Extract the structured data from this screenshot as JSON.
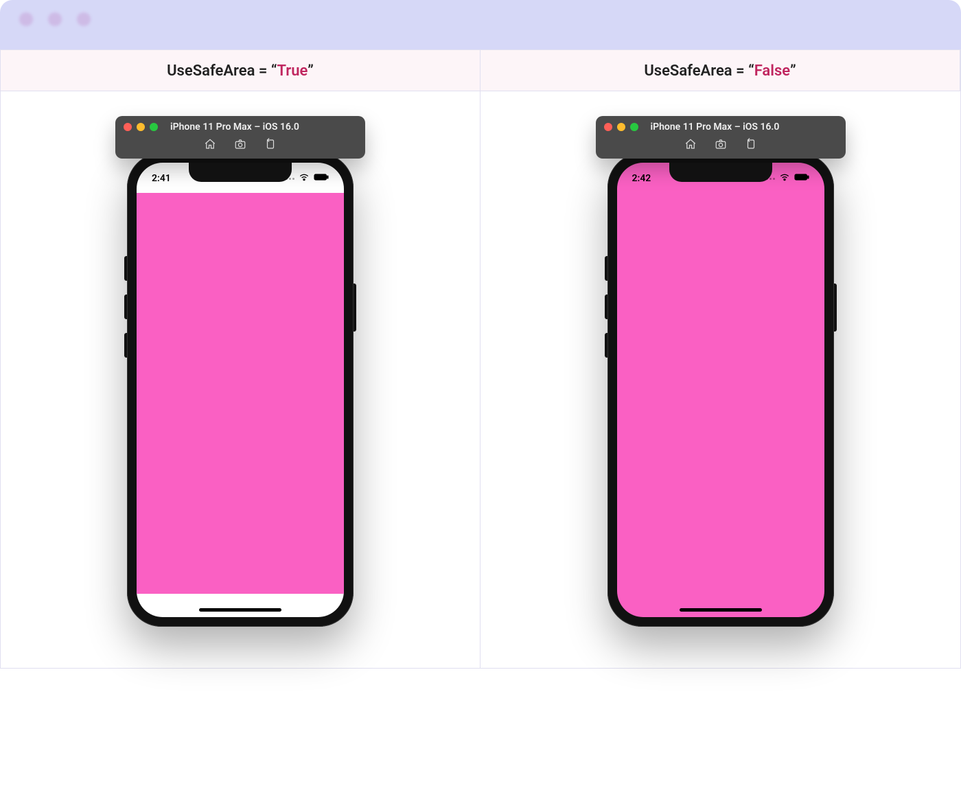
{
  "header": {
    "prop_name": "UseSafeArea",
    "equals": " = ",
    "quote_open": "“",
    "quote_close": "”"
  },
  "columns": [
    {
      "value": "True",
      "sim_title": "iPhone 11 Pro Max – iOS 16.0",
      "time": "2:41",
      "safe_area": true
    },
    {
      "value": "False",
      "sim_title": "iPhone 11 Pro Max – iOS 16.0",
      "time": "2:42",
      "safe_area": false
    }
  ],
  "icons": {
    "home": "home-icon",
    "screenshot": "screenshot-icon",
    "rotate": "rotate-icon",
    "wifi": "wifi-icon",
    "battery": "battery-icon"
  },
  "colors": {
    "content": "#fa60c3",
    "accent": "#c0265f",
    "lavender": "#d6d8f7"
  }
}
